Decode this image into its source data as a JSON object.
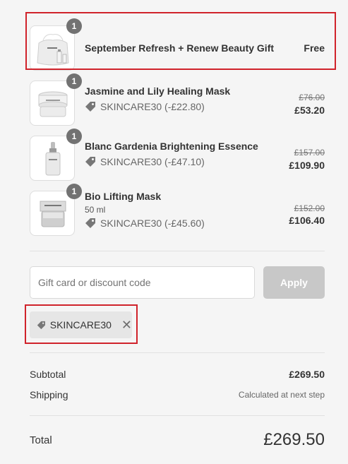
{
  "line_items": [
    {
      "quantity": "1",
      "name": "September Refresh + Renew Beauty Gift",
      "price": "Free",
      "image_icon": "gift-bag-icon"
    },
    {
      "quantity": "1",
      "name": "Jasmine and Lily Healing Mask",
      "discount": "SKINCARE30 (-£22.80)",
      "original_price": "£76.00",
      "price": "£53.20",
      "image_icon": "jar-icon"
    },
    {
      "quantity": "1",
      "name": "Blanc Gardenia Brightening Essence",
      "discount": "SKINCARE30 (-£47.10)",
      "original_price": "£157.00",
      "price": "£109.90",
      "image_icon": "dropper-bottle-icon"
    },
    {
      "quantity": "1",
      "name": "Bio Lifting Mask",
      "variant": "50 ml",
      "discount": "SKINCARE30 (-£45.60)",
      "original_price": "£152.00",
      "price": "£106.40",
      "image_icon": "jar-icon"
    }
  ],
  "discount_form": {
    "placeholder": "Gift card or discount code",
    "value": "",
    "apply_label": "Apply"
  },
  "applied_code": {
    "code": "SKINCARE30",
    "remove_icon": "close-icon"
  },
  "summary": {
    "subtotal_label": "Subtotal",
    "subtotal_value": "£269.50",
    "shipping_label": "Shipping",
    "shipping_value": "Calculated at next step",
    "total_label": "Total",
    "total_value": "£269.50"
  },
  "colors": {
    "highlight": "#d0232b",
    "badge": "#727272",
    "apply_disabled": "#c8c8c8",
    "chip_bg": "#e6e6e6"
  }
}
